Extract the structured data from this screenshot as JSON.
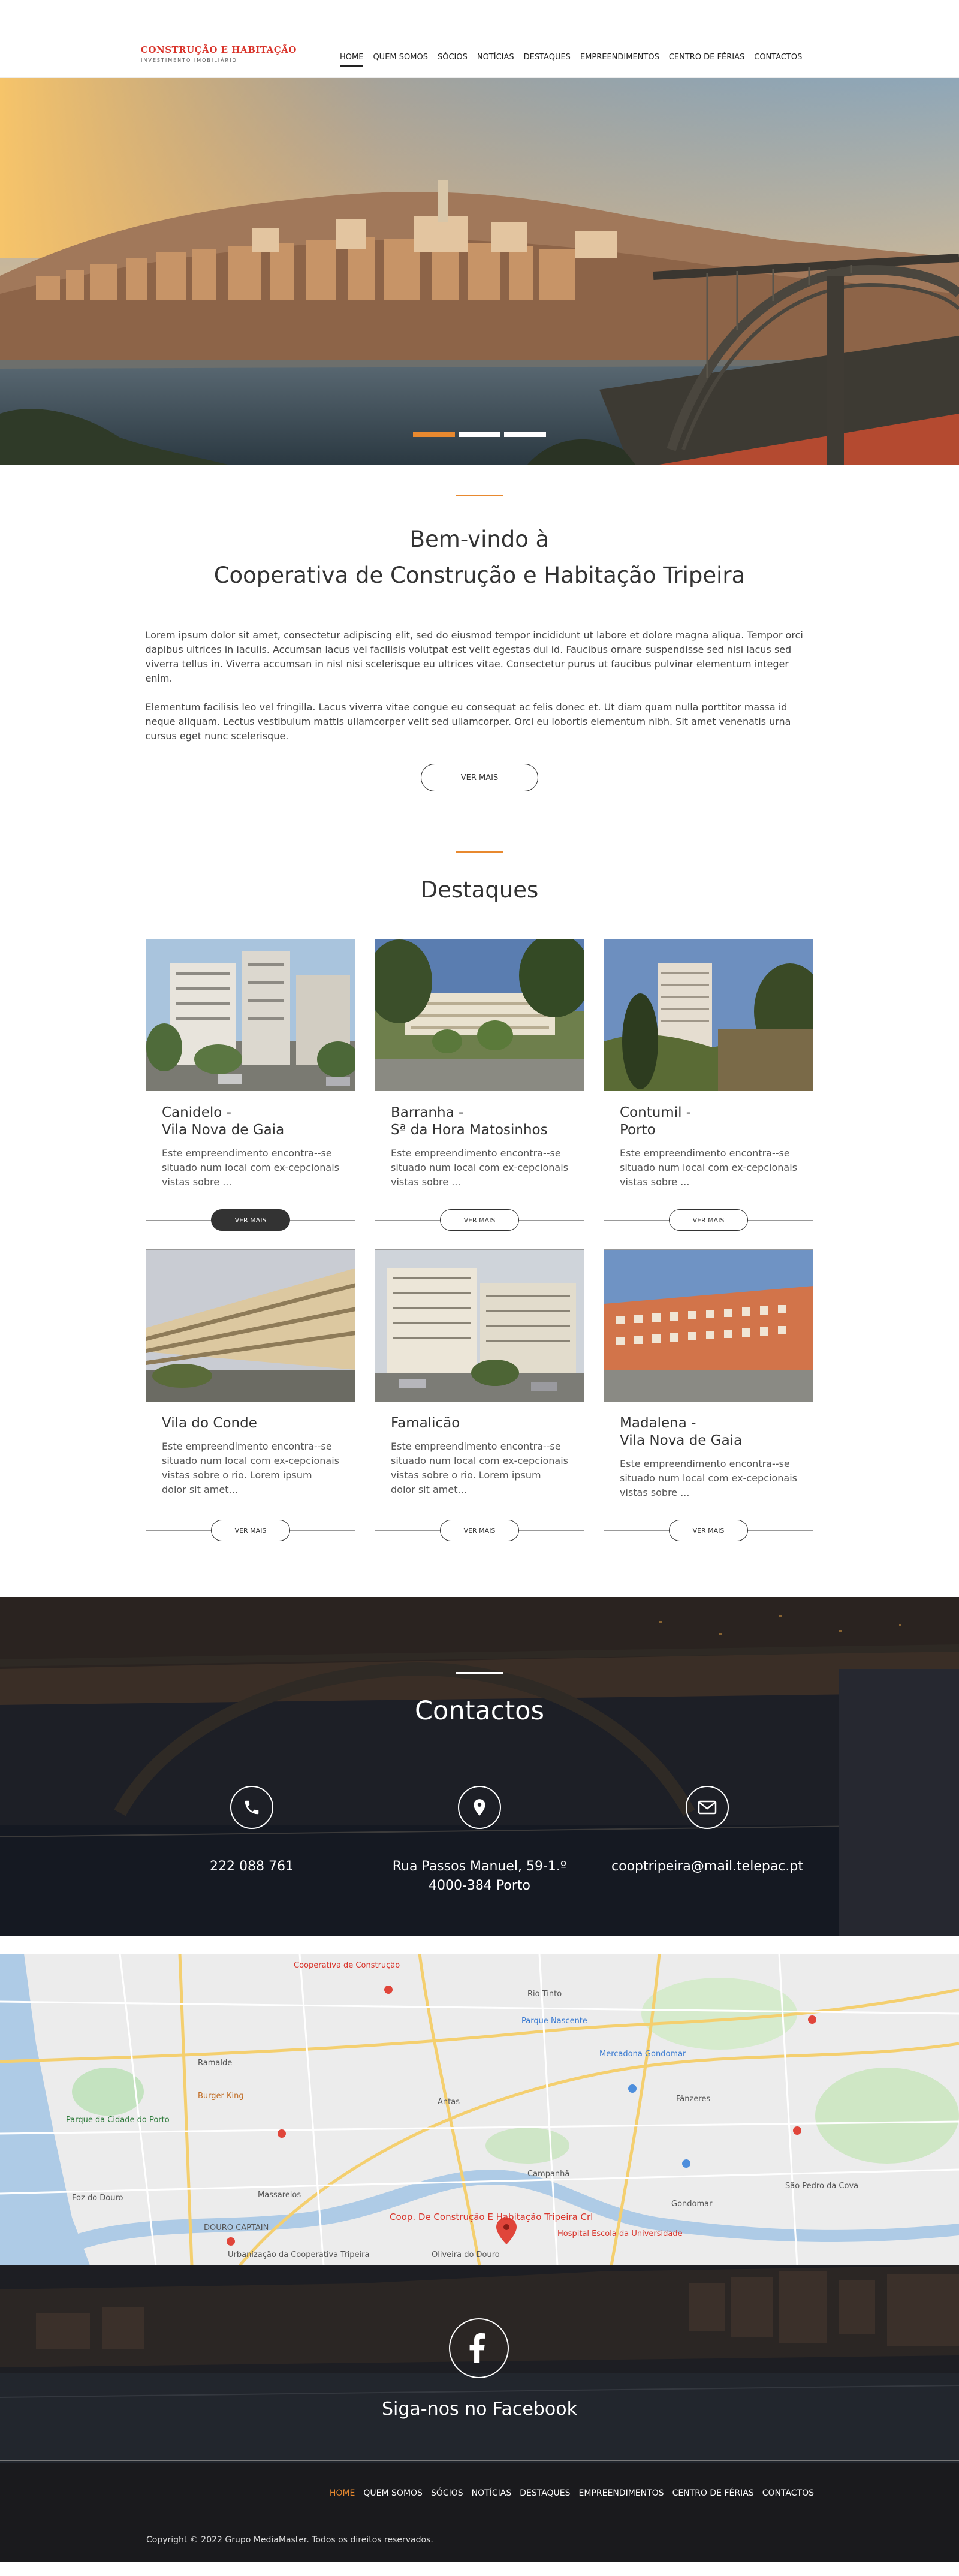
{
  "header": {
    "logo_title": "CONSTRUÇÃO E HABITAÇÃO",
    "logo_sub": "INVESTIMENTO IMOBILIÁRIO",
    "nav": [
      "HOME",
      "QUEM SOMOS",
      "SÓCIOS",
      "NOTÍCIAS",
      "DESTAQUES",
      "EMPREENDIMENTOS",
      "CENTRO DE FÉRIAS",
      "CONTACTOS"
    ],
    "active_index": 0
  },
  "hero": {
    "slides": 3,
    "active_slide": 1,
    "accent": "#e8892f"
  },
  "welcome": {
    "title_line1": "Bem-vindo à",
    "title_line2": "Cooperativa de Construção e Habitação Tripeira",
    "paragraph1": "Lorem ipsum dolor sit amet, consectetur adipiscing elit, sed do eiusmod tempor incididunt ut labore et dolore magna aliqua. Tempor orci dapibus ultrices in iaculis. Accumsan lacus vel facilisis volutpat est velit egestas dui id. Faucibus ornare suspendisse sed nisi lacus sed viverra tellus in. Viverra accumsan in nisl nisi scelerisque eu ultrices vitae. Consectetur purus ut faucibus pulvinar elementum integer enim.",
    "paragraph2": "Elementum facilisis leo vel fringilla. Lacus viverra vitae congue eu consequat ac felis donec et. Ut diam quam nulla porttitor massa id neque aliquam. Lectus vestibulum mattis ullamcorper velit sed ullamcorper. Orci eu lobortis elementum nibh. Sit amet venenatis urna cursus eget nunc scelerisque.",
    "button": "VER MAIS"
  },
  "destaques": {
    "title": "Destaques",
    "button": "VER MAIS",
    "cards": [
      {
        "line1": "Canidelo -",
        "line2": "Vila Nova de Gaia",
        "desc": "Este empreendimento encontra--se situado num local com ex-cepcionais vistas sobre ..."
      },
      {
        "line1": "Barranha -",
        "line2": "Sª da Hora Matosinhos",
        "desc": "Este empreendimento encontra--se situado num local com ex-cepcionais vistas sobre ..."
      },
      {
        "line1": "Contumil -",
        "line2": "Porto",
        "desc": "Este empreendimento encontra--se situado num local com ex-cepcionais vistas sobre ..."
      },
      {
        "line1": "Vila do Conde",
        "line2": "",
        "desc": "Este empreendimento encontra--se situado num local com ex-cepcionais vistas sobre o rio. Lorem ipsum dolor sit amet..."
      },
      {
        "line1": "Famalicão",
        "line2": "",
        "desc": "Este empreendimento encontra--se situado num local com ex-cepcionais vistas sobre o rio. Lorem ipsum dolor sit amet..."
      },
      {
        "line1": "Madalena -",
        "line2": "Vila Nova de Gaia",
        "desc": "Este empreendimento encontra--se situado num local com ex-cepcionais vistas sobre ..."
      }
    ]
  },
  "contactos": {
    "title": "Contactos",
    "phone": "222 088 761",
    "address_line1": "Rua Passos Manuel, 59-1.º",
    "address_line2": "4000-384 Porto",
    "email": "cooptripeira@mail.telepac.pt"
  },
  "map": {
    "labels": [
      "Cooperativa de Construção",
      "Rio Tinto",
      "Fânzeres",
      "Parque Nascente",
      "Mercadona Gondomar",
      "Coop. De Construção E Habitação Tripeira Crl",
      "Hospital Escola da Universidade",
      "Gondomar",
      "São Pedro da Cova",
      "Foz do Douro",
      "Massarelos",
      "DOURO CAPTAIN",
      "Urbanização da Cooperativa Tripeira",
      "Burger King",
      "Parque da Cidade do Porto",
      "Oliveira do Douro",
      "Rio Tinto",
      "Ramalde",
      "Antas",
      "Campanhã"
    ]
  },
  "footer": {
    "facebook_text": "Siga-nos no Facebook",
    "nav": [
      "HOME",
      "QUEM SOMOS",
      "SÓCIOS",
      "NOTÍCIAS",
      "DESTAQUES",
      "EMPREENDIMENTOS",
      "CENTRO DE FÉRIAS",
      "CONTACTOS"
    ],
    "copyright": "Copyright © 2022 Grupo MediaMaster. Todos os direitos reservados."
  }
}
